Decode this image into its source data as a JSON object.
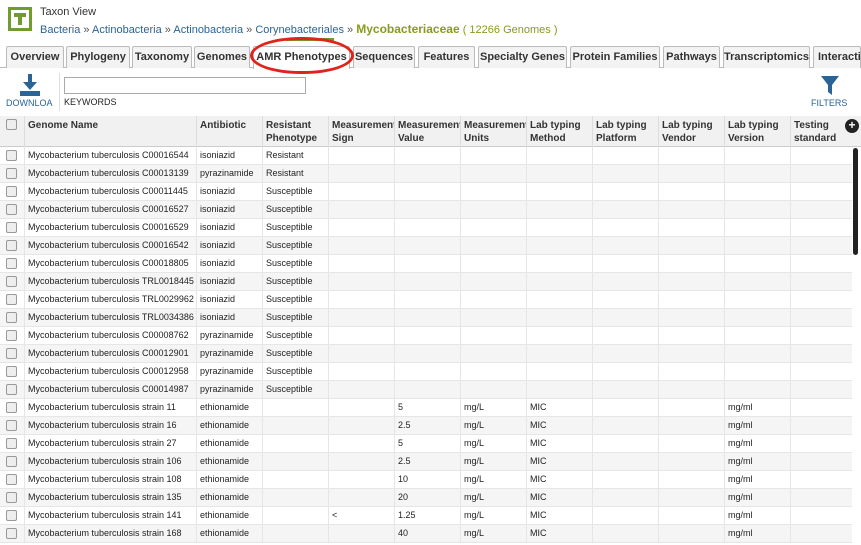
{
  "header": {
    "title": "Taxon View",
    "breadcrumbs": [
      "Bacteria",
      "Actinobacteria",
      "Actinobacteria",
      "Corynebacteriales"
    ],
    "breadcrumb_sep": "»",
    "current": "Mycobacteriaceae",
    "genome_count": "( 12266 Genomes )"
  },
  "tabs": [
    "Overview",
    "Phylogeny",
    "Taxonomy",
    "Genomes",
    "AMR Phenotypes",
    "Sequences",
    "Features",
    "Specialty Genes",
    "Protein Families",
    "Pathways",
    "Transcriptomics",
    "Interactions"
  ],
  "active_tab": "AMR Phenotypes",
  "toolbar": {
    "download_label": "DOWNLOA",
    "keywords_label": "KEYWORDS",
    "keywords_value": "",
    "filters_label": "FILTERS"
  },
  "grid": {
    "columns": [
      "Genome Name",
      "Antibiotic",
      "Resistant Phenotype",
      "Measurement Sign",
      "Measurement Value",
      "Measurement Units",
      "Lab typing Method",
      "Lab typing Platform",
      "Lab typing Vendor",
      "Lab typing Version",
      "Testing standard"
    ],
    "rows": [
      [
        "Mycobacterium tuberculosis C00016544",
        "isoniazid",
        "Resistant",
        "",
        "",
        "",
        "",
        "",
        "",
        "",
        ""
      ],
      [
        "Mycobacterium tuberculosis C00013139",
        "pyrazinamide",
        "Resistant",
        "",
        "",
        "",
        "",
        "",
        "",
        "",
        ""
      ],
      [
        "Mycobacterium tuberculosis C00011445",
        "isoniazid",
        "Susceptible",
        "",
        "",
        "",
        "",
        "",
        "",
        "",
        ""
      ],
      [
        "Mycobacterium tuberculosis C00016527",
        "isoniazid",
        "Susceptible",
        "",
        "",
        "",
        "",
        "",
        "",
        "",
        ""
      ],
      [
        "Mycobacterium tuberculosis C00016529",
        "isoniazid",
        "Susceptible",
        "",
        "",
        "",
        "",
        "",
        "",
        "",
        ""
      ],
      [
        "Mycobacterium tuberculosis C00016542",
        "isoniazid",
        "Susceptible",
        "",
        "",
        "",
        "",
        "",
        "",
        "",
        ""
      ],
      [
        "Mycobacterium tuberculosis C00018805",
        "isoniazid",
        "Susceptible",
        "",
        "",
        "",
        "",
        "",
        "",
        "",
        ""
      ],
      [
        "Mycobacterium tuberculosis TRL0018445",
        "isoniazid",
        "Susceptible",
        "",
        "",
        "",
        "",
        "",
        "",
        "",
        ""
      ],
      [
        "Mycobacterium tuberculosis TRL0029962",
        "isoniazid",
        "Susceptible",
        "",
        "",
        "",
        "",
        "",
        "",
        "",
        ""
      ],
      [
        "Mycobacterium tuberculosis TRL0034386",
        "isoniazid",
        "Susceptible",
        "",
        "",
        "",
        "",
        "",
        "",
        "",
        ""
      ],
      [
        "Mycobacterium tuberculosis C00008762",
        "pyrazinamide",
        "Susceptible",
        "",
        "",
        "",
        "",
        "",
        "",
        "",
        ""
      ],
      [
        "Mycobacterium tuberculosis C00012901",
        "pyrazinamide",
        "Susceptible",
        "",
        "",
        "",
        "",
        "",
        "",
        "",
        ""
      ],
      [
        "Mycobacterium tuberculosis C00012958",
        "pyrazinamide",
        "Susceptible",
        "",
        "",
        "",
        "",
        "",
        "",
        "",
        ""
      ],
      [
        "Mycobacterium tuberculosis C00014987",
        "pyrazinamide",
        "Susceptible",
        "",
        "",
        "",
        "",
        "",
        "",
        "",
        ""
      ],
      [
        "Mycobacterium tuberculosis strain 11",
        "ethionamide",
        "",
        "",
        "5",
        "mg/L",
        "MIC",
        "",
        "",
        "mg/ml",
        ""
      ],
      [
        "Mycobacterium tuberculosis strain 16",
        "ethionamide",
        "",
        "",
        "2.5",
        "mg/L",
        "MIC",
        "",
        "",
        "mg/ml",
        ""
      ],
      [
        "Mycobacterium tuberculosis strain 27",
        "ethionamide",
        "",
        "",
        "5",
        "mg/L",
        "MIC",
        "",
        "",
        "mg/ml",
        ""
      ],
      [
        "Mycobacterium tuberculosis strain 106",
        "ethionamide",
        "",
        "",
        "2.5",
        "mg/L",
        "MIC",
        "",
        "",
        "mg/ml",
        ""
      ],
      [
        "Mycobacterium tuberculosis strain 108",
        "ethionamide",
        "",
        "",
        "10",
        "mg/L",
        "MIC",
        "",
        "",
        "mg/ml",
        ""
      ],
      [
        "Mycobacterium tuberculosis strain 135",
        "ethionamide",
        "",
        "",
        "20",
        "mg/L",
        "MIC",
        "",
        "",
        "mg/ml",
        ""
      ],
      [
        "Mycobacterium tuberculosis strain 141",
        "ethionamide",
        "",
        "<",
        "1.25",
        "mg/L",
        "MIC",
        "",
        "",
        "mg/ml",
        ""
      ],
      [
        "Mycobacterium tuberculosis strain 168",
        "ethionamide",
        "",
        "",
        "40",
        "mg/L",
        "MIC",
        "",
        "",
        "mg/ml",
        ""
      ]
    ]
  },
  "colors": {
    "link": "#2a6496",
    "taxon": "#8a9a1b",
    "logo": "#6f9b2f",
    "highlight_circle": "#e0231b"
  }
}
